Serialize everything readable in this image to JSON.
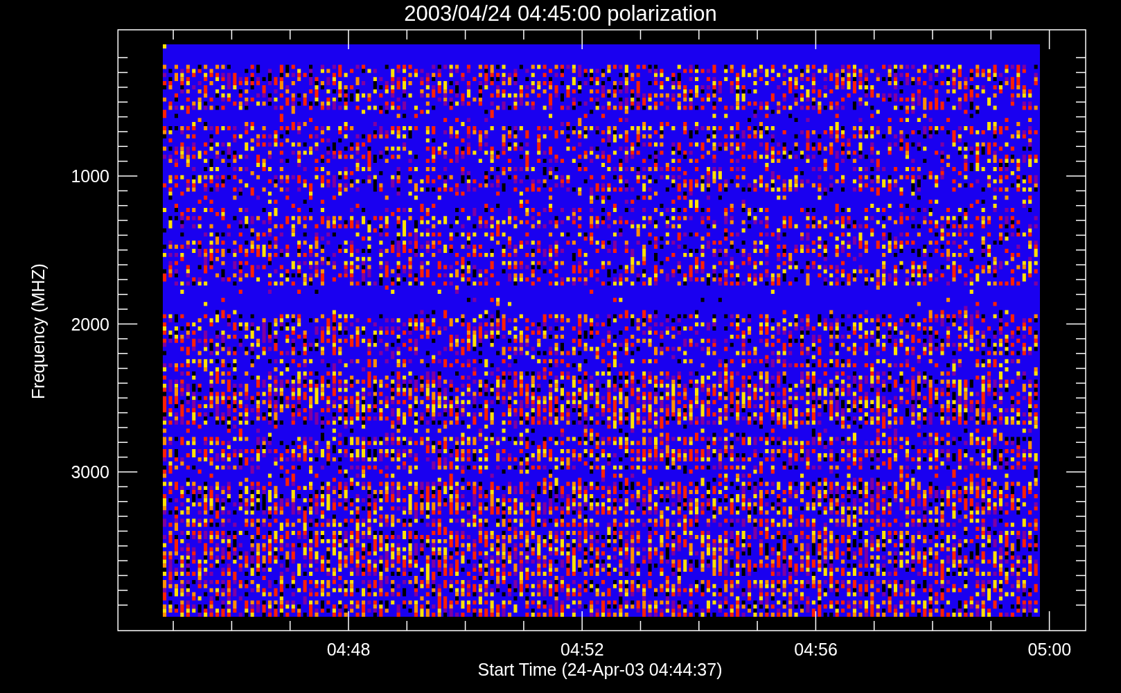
{
  "title": "2003/04/24 04:45:00 polarization",
  "y_axis": {
    "label": "Frequency (MHZ)",
    "tick_labels": [
      "1000",
      "2000",
      "3000"
    ]
  },
  "x_axis": {
    "label": "Start Time (24-Apr-03 04:44:37)",
    "tick_labels": [
      "04:48",
      "04:52",
      "04:56",
      "05:00"
    ]
  }
}
